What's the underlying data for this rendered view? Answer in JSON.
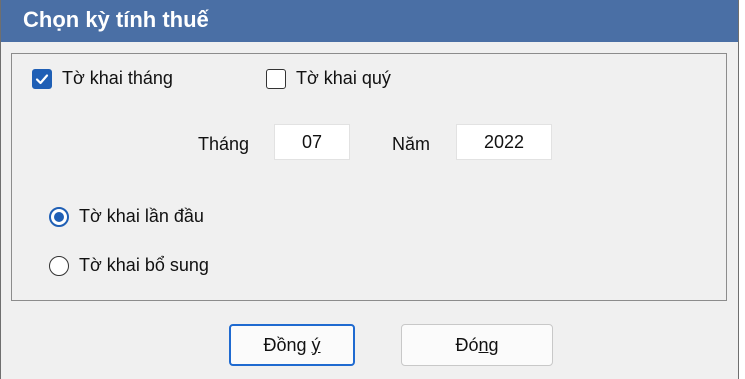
{
  "window": {
    "title": "Chọn kỳ tính thuế"
  },
  "declaration_type": {
    "monthly": {
      "label": "Tờ khai tháng",
      "checked": true
    },
    "quarterly": {
      "label": "Tờ khai quý",
      "checked": false
    }
  },
  "period": {
    "month_label": "Tháng",
    "month_value": "07",
    "year_label": "Năm",
    "year_value": "2022"
  },
  "submission": {
    "options": [
      {
        "label": "Tờ khai lần đầu",
        "selected": true
      },
      {
        "label": "Tờ khai bổ sung",
        "selected": false
      }
    ]
  },
  "buttons": {
    "ok": {
      "prefix": "Đồng ",
      "mnemonic": "ý",
      "suffix": ""
    },
    "close": {
      "prefix": "Đó",
      "mnemonic": "n",
      "suffix": "g"
    }
  },
  "colors": {
    "titlebar": "#4a6fa5",
    "accent": "#1f5fb5",
    "background": "#f0f0f0"
  }
}
